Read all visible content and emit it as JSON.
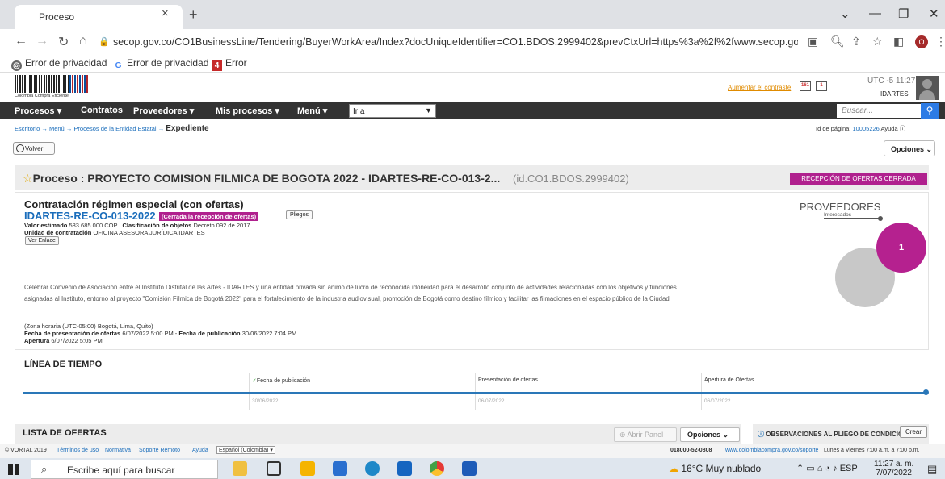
{
  "browser": {
    "tab_title": "Proceso",
    "tab_close": "×",
    "new_tab": "+",
    "url": "secop.gov.co/CO1BusinessLine/Tendering/BuyerWorkArea/Index?docUniqueIdentifier=CO1.BDOS.2999402&prevCtxUrl=https%3a%2f%2fwww.secop.go...",
    "profile_letter": "O",
    "bookmarks": [
      "Error de privacidad",
      "Error de privacidad",
      "Error"
    ]
  },
  "site": {
    "logo_text": "Colombia Compra Eficiente",
    "contrast_link": "Aumentar el contraste",
    "mail_badge": "161",
    "cal_badge": "1",
    "utc": "UTC -5 11:27:28",
    "username": "IDARTES",
    "menu": [
      "Procesos",
      "Contratos",
      "Proveedores",
      "Mis procesos",
      "Menú"
    ],
    "ira_value": "Ir a",
    "search_placeholder": "Buscar..."
  },
  "breadcrumb": {
    "items": [
      "Escritorio",
      "Menú",
      "Procesos de la Entidad Estatal"
    ],
    "current": "Expediente",
    "arrow": "→"
  },
  "page_id": {
    "label": "Id de página:",
    "value": "10005226",
    "help": "Ayuda"
  },
  "buttons": {
    "volver": "Volver",
    "opciones": "Opciones",
    "abrir_panel": "Abrir Panel",
    "crear": "Crear",
    "ver_enlace": "Ver Enlace",
    "pliegos": "Pliegos"
  },
  "process": {
    "title": "Proceso : PROYECTO COMISION FILMICA DE BOGOTA 2022 - IDARTES-RE-CO-013-2...",
    "id": "(id.CO1.BDOS.2999402)",
    "status": "RECEPCIÓN DE OFERTAS CERRADA",
    "type": "Contratación régimen especial (con ofertas)",
    "reference": "IDARTES-RE-CO-013-2022",
    "ref_status": "(Cerrada la recepción de ofertas)",
    "valor_label": "Valor estimado",
    "valor": "583.685.000 COP |",
    "clasif_label": "Clasificación de objetos",
    "clasif": "Decreto 092 de 2017",
    "unidad_label": "Unidad de contratación",
    "unidad": "OFICINA ASESORA JURÍDICA IDARTES",
    "description": "Celebrar Convenio de Asociación entre el Instituto Distrital de las Artes - IDARTES y una entidad privada sin ánimo de lucro de reconocida idoneidad para el desarrollo conjunto de actividades relacionadas con los objetivos y funciones asignadas al Instituto, entorno al proyecto \"Comisión Fílmica de Bogotá 2022\" para el fortalecimiento de la industria audiovisual, promoción de Bogotá como destino fílmico y facilitar las filmaciones en el espacio público de la Ciudad",
    "zona": "(Zona horaria (UTC-05:00) Bogotá, Lima, Quito)",
    "fecha_pres_label": "Fecha de presentación de ofertas",
    "fecha_pres": "6/07/2022 5:00 PM -",
    "fecha_pub_label": "Fecha de publicación",
    "fecha_pub": "30/06/2022 7:04 PM",
    "apertura_label": "Apertura",
    "apertura": "6/07/2022 5:05 PM"
  },
  "providers": {
    "title": "PROVEEDORES",
    "subtitle": "Interesados",
    "count": "1"
  },
  "timeline": {
    "title": "LÍNEA DE TIEMPO",
    "columns": [
      {
        "label": "Fecha de publicación",
        "date": "30/06/2022"
      },
      {
        "label": "Presentación de ofertas",
        "date": "06/07/2022"
      },
      {
        "label": "Apertura de Ofertas",
        "date": "06/07/2022"
      }
    ]
  },
  "offers": {
    "title": "LISTA DE OFERTAS",
    "observaciones": "OBSERVACIONES AL PLIEGO DE CONDICIONES"
  },
  "footer": {
    "copyright": "© VORTAL 2019",
    "links": [
      "Términos de uso",
      "Normativa",
      "Soporte Remoto",
      "Ayuda"
    ],
    "language": "Español (Colombia)",
    "phone": "018000-52-0808",
    "support_url": "www.colombiacompra.gov.co/soporte",
    "hours": "Lunes a Viernes 7:00 a.m. a 7:00 p.m."
  },
  "taskbar": {
    "search": "Escribe aquí para buscar",
    "weather": "16°C  Muy nublado",
    "lang": "ESP",
    "time": "11:27 a. m.",
    "date": "7/07/2022"
  }
}
